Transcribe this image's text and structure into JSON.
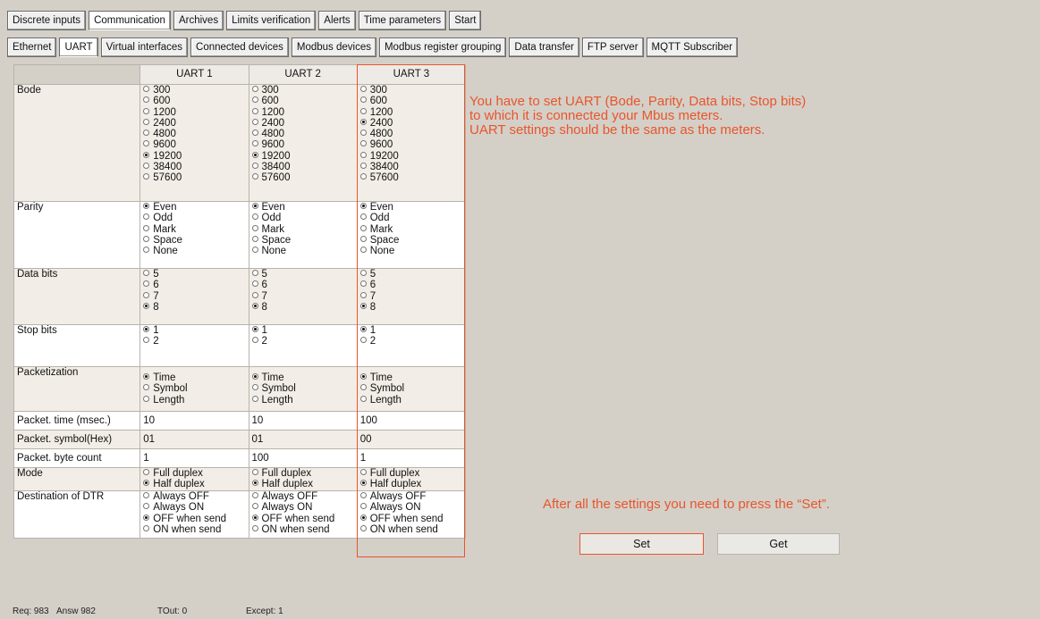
{
  "top_tabs": [
    "Discrete inputs",
    "Communication",
    "Archives",
    "Limits verification",
    "Alerts",
    "Time parameters",
    "Start"
  ],
  "top_active": 1,
  "sub_tabs": [
    "Ethernet",
    "UART",
    "Virtual interfaces",
    "Connected devices",
    "Modbus devices",
    "Modbus register grouping",
    "Data transfer",
    "FTP server",
    "MQTT Subscriber"
  ],
  "sub_active": 1,
  "grid": {
    "columns": [
      "UART 1",
      "UART 2",
      "UART 3"
    ],
    "labels": {
      "bode": "Bode",
      "parity": "Parity",
      "data_bits": "Data bits",
      "stop_bits": "Stop bits",
      "packetization": "Packetization",
      "packet_time": "Packet. time (msec.)",
      "packet_symbol": "Packet. symbol(Hex)",
      "packet_byte_count": "Packet. byte count",
      "mode": "Mode",
      "dtr": "Destination of DTR"
    },
    "options": {
      "bode": [
        "300",
        "600",
        "1200",
        "2400",
        "4800",
        "9600",
        "19200",
        "38400",
        "57600"
      ],
      "parity": [
        "Even",
        "Odd",
        "Mark",
        "Space",
        "None"
      ],
      "data_bits": [
        "5",
        "6",
        "7",
        "8"
      ],
      "stop_bits": [
        "1",
        "2"
      ],
      "packetization": [
        "Time",
        "Symbol",
        "Length"
      ],
      "mode": [
        "Full duplex",
        "Half duplex"
      ],
      "dtr": [
        "Always OFF",
        "Always ON",
        "OFF when send",
        "ON when send"
      ]
    },
    "uarts": [
      {
        "bode": "19200",
        "parity": "Even",
        "data_bits": "8",
        "stop_bits": "1",
        "packetization": "Time",
        "packet_time": "10",
        "packet_symbol": "01",
        "packet_byte_count": "1",
        "mode": "Half duplex",
        "dtr": "OFF when send"
      },
      {
        "bode": "19200",
        "parity": "Even",
        "data_bits": "8",
        "stop_bits": "1",
        "packetization": "Time",
        "packet_time": "10",
        "packet_symbol": "01",
        "packet_byte_count": "100",
        "mode": "Half duplex",
        "dtr": "OFF when send"
      },
      {
        "bode": "2400",
        "parity": "Even",
        "data_bits": "8",
        "stop_bits": "1",
        "packetization": "Time",
        "packet_time": "100",
        "packet_symbol": "00",
        "packet_byte_count": "1",
        "mode": "Half duplex",
        "dtr": "OFF when send"
      }
    ]
  },
  "annotations": {
    "note1_lines": [
      "You have to set UART  (Bode, Parity, Data bits, Stop bits)",
      "to which it is connected your Mbus meters.",
      "UART settings should be the same as the meters."
    ],
    "note2": "After all the settings you need to press the “Set”."
  },
  "buttons": {
    "set": "Set",
    "get": "Get"
  },
  "status": {
    "req": "Req: 983",
    "answ": "Answ   982",
    "tout": "TOut: 0",
    "except": "Except:  1"
  },
  "colors": {
    "highlight": "#e8552c",
    "panel": "#d4d0c8"
  }
}
